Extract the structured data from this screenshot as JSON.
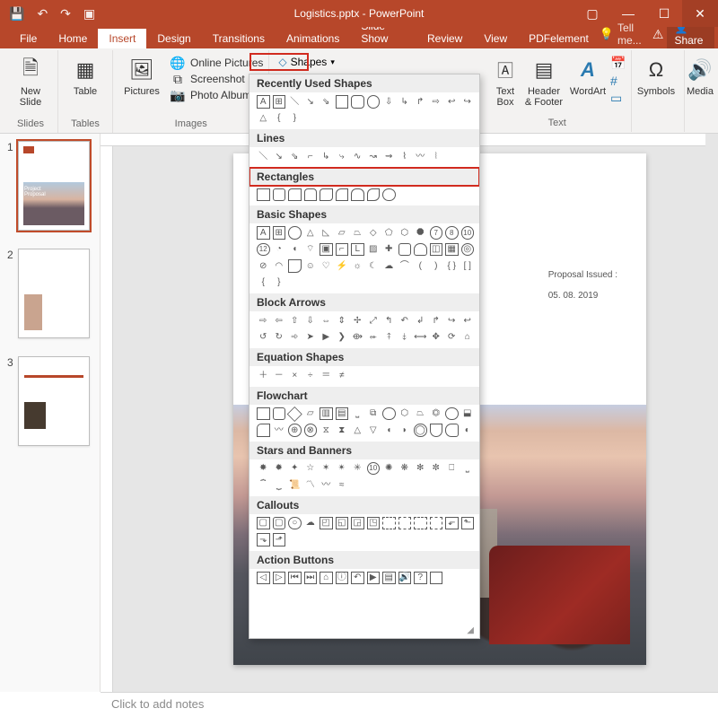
{
  "titlebar": {
    "app_title": "Logistics.pptx - PowerPoint"
  },
  "menu": {
    "file": "File",
    "home": "Home",
    "insert": "Insert",
    "design": "Design",
    "transitions": "Transitions",
    "animations": "Animations",
    "slideshow": "Slide Show",
    "review": "Review",
    "view": "View",
    "pdfelement": "PDFelement",
    "tell_me": "Tell me...",
    "share": "Share"
  },
  "ribbon": {
    "new_slide": "New\nSlide",
    "table": "Table",
    "pictures": "Pictures",
    "online_pictures": "Online Pictures",
    "screenshot": "Screenshot",
    "photo_album": "Photo Album",
    "shapes": "Shapes",
    "text_box": "Text\nBox",
    "header_footer": "Header\n& Footer",
    "wordart": "WordArt",
    "symbols": "Symbols",
    "media": "Media",
    "group_slides": "Slides",
    "group_tables": "Tables",
    "group_images": "Images",
    "group_text": "Text"
  },
  "shapes_menu": {
    "recently_used": "Recently Used Shapes",
    "lines": "Lines",
    "rectangles": "Rectangles",
    "basic_shapes": "Basic Shapes",
    "block_arrows": "Block Arrows",
    "equation_shapes": "Equation Shapes",
    "flowchart": "Flowchart",
    "stars_banners": "Stars and Banners",
    "callouts": "Callouts",
    "action_buttons": "Action Buttons"
  },
  "slide_content": {
    "proposal_label": "Proposal Issued :",
    "proposal_date": "05. 08. 2019",
    "t1_text": "Project\nProposal"
  },
  "thumbs": {
    "n1": "1",
    "n2": "2",
    "n3": "3"
  },
  "notes": {
    "placeholder": "Click to add notes"
  }
}
